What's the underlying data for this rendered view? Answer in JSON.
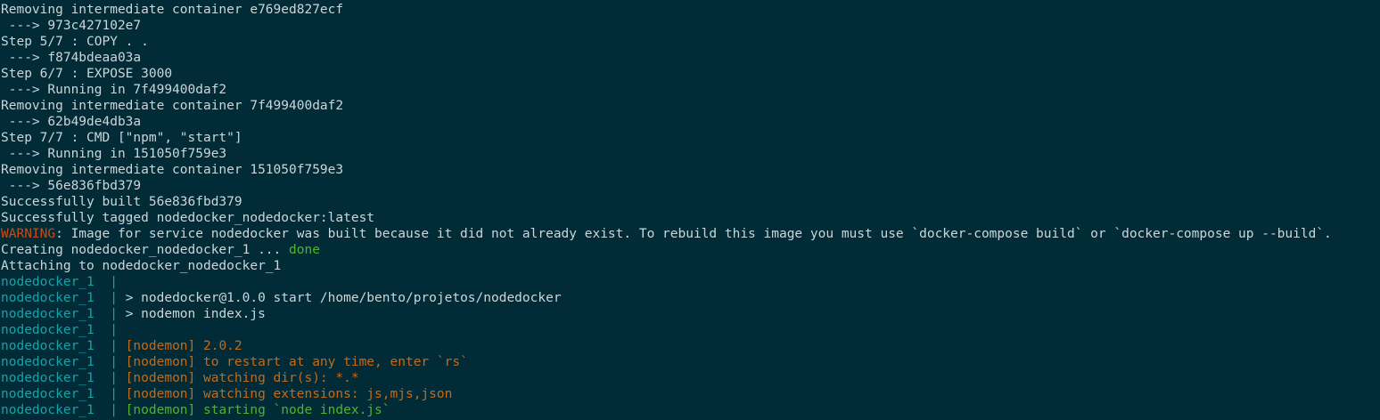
{
  "terminal": {
    "colors": {
      "background": "#012b36",
      "default": "#ccd6da",
      "warning": "#cb4b16",
      "green": "#4fb32f",
      "cyan": "#15a3a8",
      "orange": "#c56a1a"
    },
    "lines": [
      [
        {
          "text": "Removing intermediate container e769ed827ecf",
          "color": "default"
        }
      ],
      [
        {
          "text": " ---> 973c427102e7",
          "color": "default"
        }
      ],
      [
        {
          "text": "Step 5/7 : COPY . .",
          "color": "default"
        }
      ],
      [
        {
          "text": " ---> f874bdeaa03a",
          "color": "default"
        }
      ],
      [
        {
          "text": "Step 6/7 : EXPOSE 3000",
          "color": "default"
        }
      ],
      [
        {
          "text": " ---> Running in 7f499400daf2",
          "color": "default"
        }
      ],
      [
        {
          "text": "Removing intermediate container 7f499400daf2",
          "color": "default"
        }
      ],
      [
        {
          "text": " ---> 62b49de4db3a",
          "color": "default"
        }
      ],
      [
        {
          "text": "Step 7/7 : CMD [\"npm\", \"start\"]",
          "color": "default"
        }
      ],
      [
        {
          "text": " ---> Running in 151050f759e3",
          "color": "default"
        }
      ],
      [
        {
          "text": "Removing intermediate container 151050f759e3",
          "color": "default"
        }
      ],
      [
        {
          "text": " ---> 56e836fbd379",
          "color": "default"
        }
      ],
      [
        {
          "text": "Successfully built 56e836fbd379",
          "color": "default"
        }
      ],
      [
        {
          "text": "Successfully tagged nodedocker_nodedocker:latest",
          "color": "default"
        }
      ],
      [
        {
          "text": "WARNING",
          "color": "warning"
        },
        {
          "text": ": Image for service nodedocker was built because it did not already exist. To rebuild this image you must use `docker-compose build` or `docker-compose up --build`.",
          "color": "default"
        }
      ],
      [
        {
          "text": "Creating nodedocker_nodedocker_1 ... ",
          "color": "default"
        },
        {
          "text": "done",
          "color": "green"
        }
      ],
      [
        {
          "text": "Attaching to nodedocker_nodedocker_1",
          "color": "default"
        }
      ],
      [
        {
          "text": "nodedocker_1  | ",
          "color": "cyan"
        }
      ],
      [
        {
          "text": "nodedocker_1  | ",
          "color": "cyan"
        },
        {
          "text": "> nodedocker@1.0.0 start /home/bento/projetos/nodedocker",
          "color": "default"
        }
      ],
      [
        {
          "text": "nodedocker_1  | ",
          "color": "cyan"
        },
        {
          "text": "> nodemon index.js",
          "color": "default"
        }
      ],
      [
        {
          "text": "nodedocker_1  | ",
          "color": "cyan"
        }
      ],
      [
        {
          "text": "nodedocker_1  | ",
          "color": "cyan"
        },
        {
          "text": "[nodemon] 2.0.2",
          "color": "orange"
        }
      ],
      [
        {
          "text": "nodedocker_1  | ",
          "color": "cyan"
        },
        {
          "text": "[nodemon] to restart at any time, enter `rs`",
          "color": "orange"
        }
      ],
      [
        {
          "text": "nodedocker_1  | ",
          "color": "cyan"
        },
        {
          "text": "[nodemon] watching dir(s): *.*",
          "color": "orange"
        }
      ],
      [
        {
          "text": "nodedocker_1  | ",
          "color": "cyan"
        },
        {
          "text": "[nodemon] watching extensions: js,mjs,json",
          "color": "orange"
        }
      ],
      [
        {
          "text": "nodedocker_1  | ",
          "color": "cyan"
        },
        {
          "text": "[nodemon] starting `node index.js`",
          "color": "green"
        }
      ]
    ]
  }
}
